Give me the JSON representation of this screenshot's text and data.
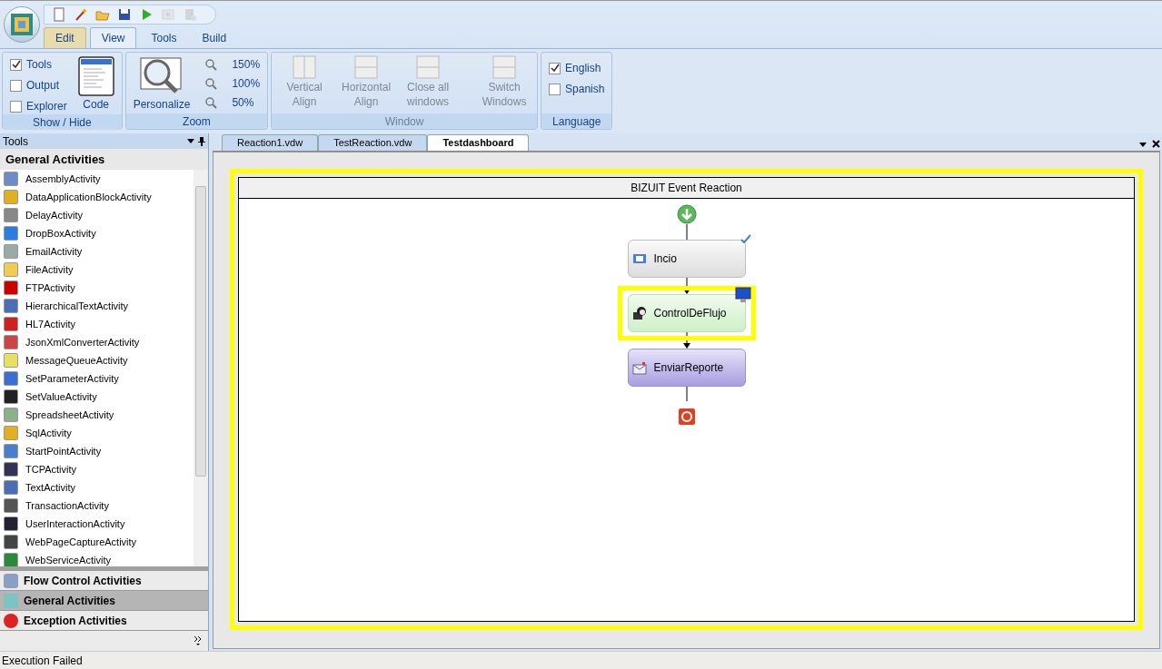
{
  "quick_access": [
    {
      "kind": "new",
      "disabled": false
    },
    {
      "kind": "wand",
      "disabled": false
    },
    {
      "kind": "open",
      "disabled": false
    },
    {
      "kind": "save",
      "disabled": false
    },
    {
      "kind": "run",
      "disabled": false
    },
    {
      "kind": "step",
      "disabled": true
    },
    {
      "kind": "stop",
      "disabled": true
    }
  ],
  "ribbon_tabs": [
    {
      "label": "Edit",
      "selected": false
    },
    {
      "label": "View",
      "selected": true
    },
    {
      "label": "Tools",
      "selected": false
    },
    {
      "label": "Build",
      "selected": false
    }
  ],
  "ribbon_groups": [
    {
      "kind": "show_hide",
      "title": "Show / Hide",
      "checks": [
        {
          "label": "Tools",
          "checked": true
        },
        {
          "label": "Output",
          "checked": false
        },
        {
          "label": "Explorer",
          "checked": false
        }
      ],
      "button": "Code"
    },
    {
      "kind": "zoom",
      "title": "Zoom",
      "button": "Personalize",
      "levels": [
        "150%",
        "100%",
        "50%"
      ]
    },
    {
      "kind": "window",
      "title": "Window",
      "buttons": [
        {
          "label": "Vertical Align",
          "disabled": true
        },
        {
          "label": "Horizontal Align",
          "disabled": true
        },
        {
          "label": "Close all windows",
          "disabled": true
        },
        {
          "label": "Switch Windows",
          "disabled": true
        }
      ]
    },
    {
      "kind": "language",
      "title": "Language",
      "checks": [
        {
          "label": "English",
          "checked": true
        },
        {
          "label": "Spanish",
          "checked": false
        }
      ]
    }
  ],
  "toolbox": {
    "title": "Tools",
    "section": "General Activities",
    "items": [
      "AssemblyActivity",
      "DataApplicationBlockActivity",
      "DelayActivity",
      "DropBoxActivity",
      "EmailActivity",
      "FileActivity",
      "FTPActivity",
      "HierarchicalTextActivity",
      "HL7Activity",
      "JsonXmlConverterActivity",
      "MessageQueueActivity",
      "SetParameterActivity",
      "SetValueActivity",
      "SpreadsheetActivity",
      "SqlActivity",
      "StartPointActivity",
      "TCPActivity",
      "TextActivity",
      "TransactionActivity",
      "UserInteractionActivity",
      "WebPageCaptureActivity",
      "WebServiceActivity"
    ],
    "categories": [
      {
        "label": "Flow Control Activities",
        "selected": false
      },
      {
        "label": "General Activities",
        "selected": true
      },
      {
        "label": "Exception Activities",
        "selected": false
      }
    ]
  },
  "document_tabs": [
    {
      "label": "Reaction1.vdw",
      "selected": false
    },
    {
      "label": "TestReaction.vdw",
      "selected": false
    },
    {
      "label": "Testdashboard",
      "selected": true
    }
  ],
  "designer": {
    "title": "BIZUIT Event Reaction",
    "nodes": [
      {
        "label": "Incio",
        "kind": "start",
        "selected": false,
        "checked": true
      },
      {
        "label": "ControlDeFlujo",
        "kind": "flow",
        "selected": true,
        "checked": false
      },
      {
        "label": "EnviarReporte",
        "kind": "email",
        "selected": false,
        "checked": false
      }
    ]
  },
  "status_bar": "Execution Failed"
}
